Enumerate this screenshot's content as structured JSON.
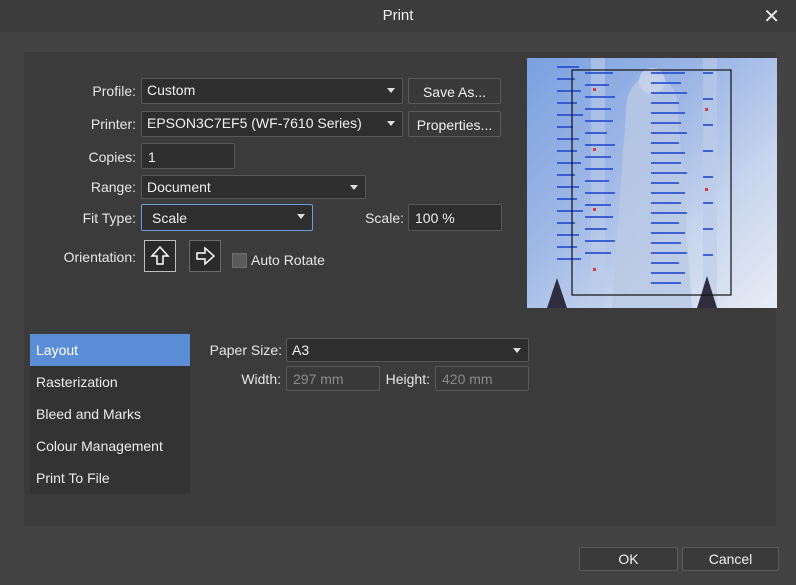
{
  "title": "Print",
  "profile": {
    "label": "Profile:",
    "value": "Custom",
    "save_as": "Save As..."
  },
  "printer": {
    "label": "Printer:",
    "value": "EPSON3C7EF5 (WF-7610 Series)",
    "properties": "Properties..."
  },
  "copies": {
    "label": "Copies:",
    "value": "1"
  },
  "range": {
    "label": "Range:",
    "value": "Document"
  },
  "fit_type": {
    "label": "Fit Type:",
    "value": "Scale"
  },
  "scale": {
    "label": "Scale:",
    "value": "100 %"
  },
  "orientation": {
    "label": "Orientation:",
    "selected": "portrait"
  },
  "auto_rotate": {
    "label": "Auto Rotate",
    "checked": false
  },
  "sections": [
    {
      "label": "Layout",
      "active": true
    },
    {
      "label": "Rasterization",
      "active": false
    },
    {
      "label": "Bleed and Marks",
      "active": false
    },
    {
      "label": "Colour Management",
      "active": false
    },
    {
      "label": "Print To File",
      "active": false
    }
  ],
  "paper": {
    "size_label": "Paper Size:",
    "size_value": "A3",
    "width_label": "Width:",
    "width_value": "297 mm",
    "height_label": "Height:",
    "height_value": "420 mm"
  },
  "footer": {
    "ok": "OK",
    "cancel": "Cancel"
  },
  "colors": {
    "accent": "#5b8dd6",
    "dialog_bg": "#434343",
    "panel_bg": "#3b3b3b"
  }
}
